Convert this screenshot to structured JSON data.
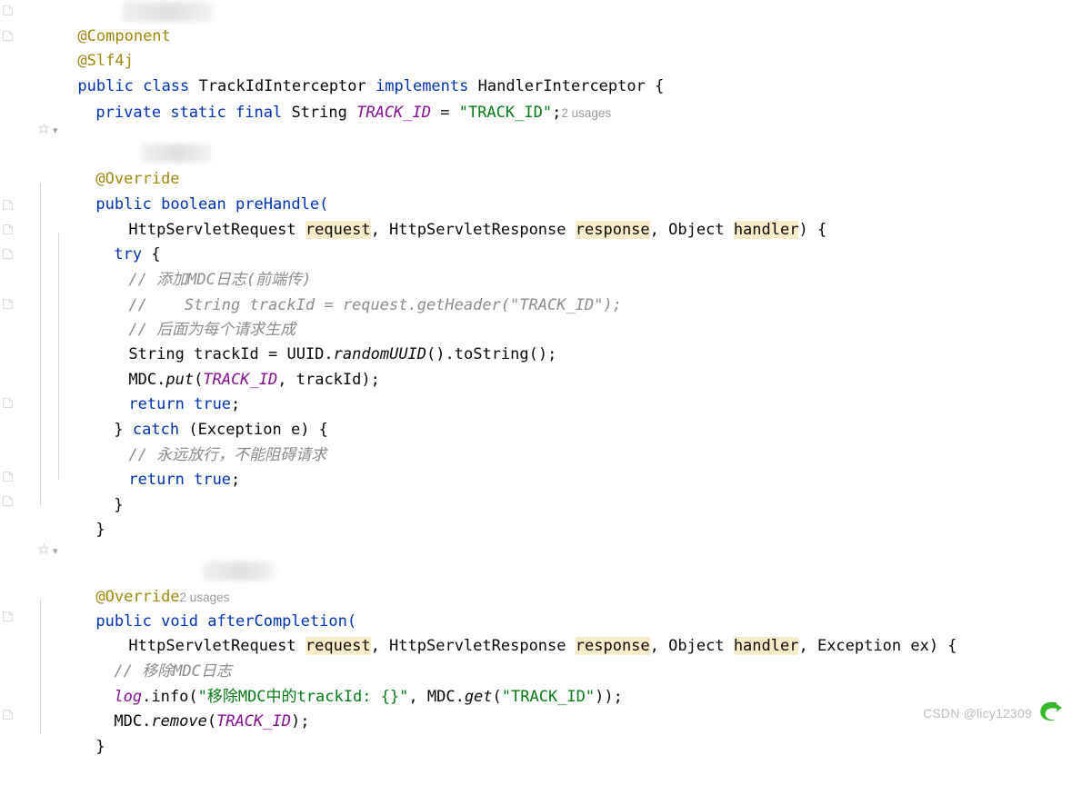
{
  "app": {
    "kind": "code-editor",
    "language": "Java",
    "theme": "IntelliJ Light"
  },
  "colors": {
    "background": "#ffffff",
    "foreground": "#080808",
    "keyword": "#0033b3",
    "annotation": "#9e880d",
    "string": "#067d17",
    "comment": "#8c8c8c",
    "constant_field": "#871094",
    "param_highlight": "#faecc9",
    "inlay_hint": "#9a9a9a",
    "indent_guide": "#d3d3d3",
    "watermark_text": "#b9bcbe",
    "watermark_logo": "#35b82a"
  },
  "inlay_hints": {
    "track_id_usages": "2 usages",
    "after_completion_usages": "2 usages"
  },
  "code_lines": [
    {
      "id": "l1",
      "indent": 0,
      "text": "@Component"
    },
    {
      "id": "l2",
      "indent": 0,
      "text": "@Slf4j"
    },
    {
      "id": "l3",
      "indent": 0,
      "text": "public class TrackIdInterceptor implements HandlerInterceptor {"
    },
    {
      "id": "l4",
      "indent": 1,
      "text": "private static final String TRACK_ID = \"TRACK_ID\";  2 usages"
    },
    {
      "id": "l5",
      "indent": 0,
      "text": ""
    },
    {
      "id": "l6",
      "indent": 1,
      "text": "[gutter: implements-method icon]"
    },
    {
      "id": "l7",
      "indent": 1,
      "text": "@Override"
    },
    {
      "id": "l8",
      "indent": 1,
      "text": "public boolean preHandle("
    },
    {
      "id": "l9",
      "indent": 2,
      "text": "HttpServletRequest request, HttpServletResponse response, Object handler) {"
    },
    {
      "id": "l10",
      "indent": 1,
      "text": "try {"
    },
    {
      "id": "l11",
      "indent": 2,
      "text": "// 添加MDC日志(前端传)"
    },
    {
      "id": "l12",
      "indent": 2,
      "text": "//    String trackId = request.getHeader(\"TRACK_ID\");"
    },
    {
      "id": "l13",
      "indent": 2,
      "text": "// 后面为每个请求生成"
    },
    {
      "id": "l14",
      "indent": 2,
      "text": "String trackId = UUID.randomUUID().toString();"
    },
    {
      "id": "l15",
      "indent": 2,
      "text": "MDC.put(TRACK_ID, trackId);"
    },
    {
      "id": "l16",
      "indent": 2,
      "text": "return true;"
    },
    {
      "id": "l17",
      "indent": 1,
      "text": "} catch (Exception e) {"
    },
    {
      "id": "l18",
      "indent": 2,
      "text": "// 永远放行，不能阻碍请求"
    },
    {
      "id": "l19",
      "indent": 2,
      "text": "return true;"
    },
    {
      "id": "l20",
      "indent": 1,
      "text": "}"
    },
    {
      "id": "l21",
      "indent": 0,
      "text": "}"
    },
    {
      "id": "l22",
      "indent": 0,
      "text": ""
    },
    {
      "id": "l23",
      "indent": 1,
      "text": "[gutter: implements-method icon]"
    },
    {
      "id": "l24",
      "indent": 1,
      "text": "@Override  2 usages"
    },
    {
      "id": "l25",
      "indent": 1,
      "text": "public void afterCompletion("
    },
    {
      "id": "l26",
      "indent": 2,
      "text": "HttpServletRequest request, HttpServletResponse response, Object handler, Exception ex) {"
    },
    {
      "id": "l27",
      "indent": 2,
      "text": "// 移除MDC日志"
    },
    {
      "id": "l28",
      "indent": 2,
      "text": "log.info(\"移除MDC中的trackId: {}\", MDC.get(\"TRACK_ID\"));"
    },
    {
      "id": "l29",
      "indent": 2,
      "text": "MDC.remove(TRACK_ID);"
    },
    {
      "id": "l30",
      "indent": 0,
      "text": "}"
    }
  ],
  "tokens": {
    "at_component": "@Component",
    "at_slf4j": "@Slf4j",
    "kw_public": "public",
    "kw_class": "class",
    "kw_implements": "implements",
    "kw_private": "private",
    "kw_static": "static",
    "kw_final": "final",
    "kw_boolean": "boolean",
    "kw_void": "void",
    "kw_try": "try",
    "kw_catch": "catch",
    "kw_return": "return",
    "kw_true": "true",
    "t_string": "String",
    "t_uuid": "UUID",
    "t_mdc": "MDC",
    "t_exception": "Exception",
    "t_object": "Object",
    "t_http_req": "HttpServletRequest",
    "t_http_res": "HttpServletResponse",
    "cls_name": "TrackIdInterceptor",
    "iface_name": "HandlerInterceptor",
    "const_track_id": "TRACK_ID",
    "str_track_id": "\"TRACK_ID\"",
    "at_override": "@Override",
    "m_pre_handle": "preHandle",
    "m_after_completion": "afterCompletion",
    "p_request": "request",
    "p_response": "response",
    "p_handler": "handler",
    "p_ex": "ex",
    "p_e": "e",
    "v_track_id": "trackId",
    "m_random_uuid": "randomUUID",
    "m_to_string": "toString",
    "m_put": "put",
    "m_get": "get",
    "m_remove": "remove",
    "m_info": "info",
    "fld_log": "log",
    "cmt_add_mdc": "// 添加MDC日志(前端传)",
    "cmt_commented_code": "//    String trackId = request.getHeader(\"TRACK_ID\");",
    "cmt_gen_per_request": "// 后面为每个请求生成",
    "cmt_always_pass": "// 永远放行，不能阻碍请求",
    "cmt_remove_mdc": "// 移除MDC日志",
    "str_log_msg": "\"移除MDC中的trackId: {}\""
  },
  "watermark": {
    "text": "CSDN @licy12309",
    "logo": "csdn-logo-icon"
  }
}
